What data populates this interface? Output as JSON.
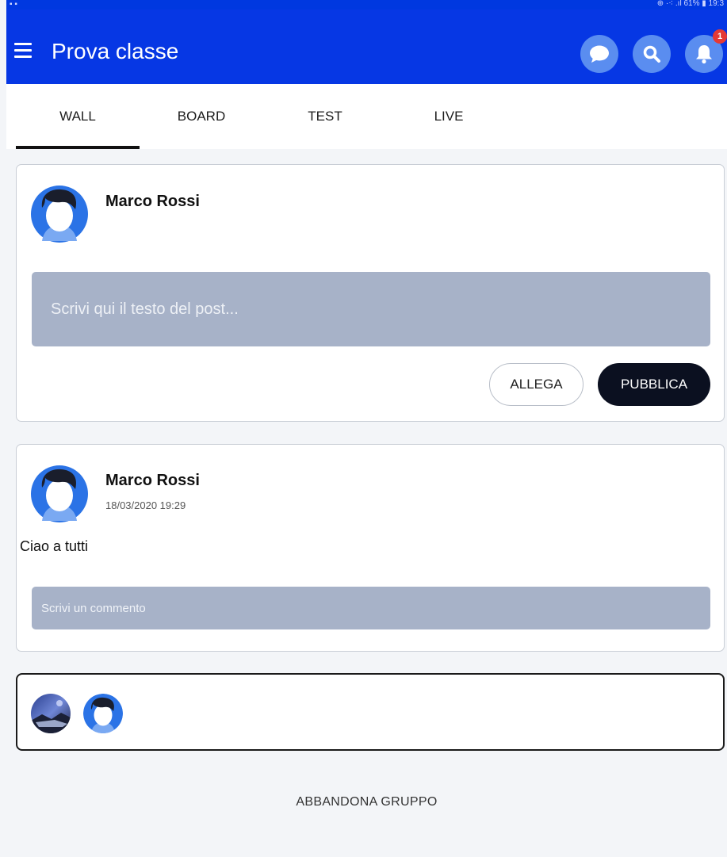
{
  "status_bar": {
    "left": "▪ ▪",
    "right": "⊕ ·⁖ .ıl 61% ▮ 19:3"
  },
  "app_bar": {
    "title": "Prova classe",
    "icons": [
      "menu-icon",
      "chat-bubble-icon",
      "search-icon",
      "bell-icon"
    ],
    "notification_count": "1",
    "color": "#0637e4"
  },
  "tabs": [
    {
      "label": "WALL",
      "active": true
    },
    {
      "label": "BOARD",
      "active": false
    },
    {
      "label": "TEST",
      "active": false
    },
    {
      "label": "LIVE",
      "active": false
    }
  ],
  "composer": {
    "user_name": "Marco Rossi",
    "placeholder": "Scrivi qui il testo del post...",
    "attach_label": "ALLEGA",
    "publish_label": "PUBBLICA"
  },
  "post": {
    "user_name": "Marco Rossi",
    "date": "18/03/2020 19:29",
    "text": "Ciao a tutti",
    "comment_placeholder": "Scrivi un commento"
  },
  "members": {
    "avatars": [
      "landscape-photo-avatar",
      "default-user-avatar"
    ]
  },
  "leave_group_label": "ABBANDONA GRUPPO",
  "colors": {
    "accent": "#0637e4",
    "input_bg": "#a7b2c8",
    "primary_button": "#0b1020"
  }
}
